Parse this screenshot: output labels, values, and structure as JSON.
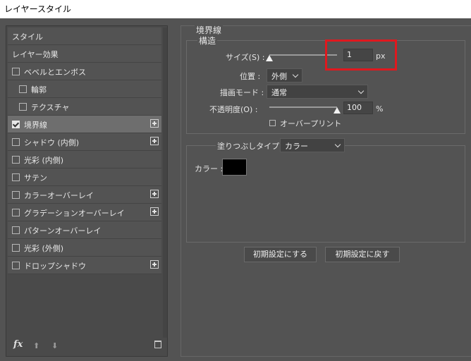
{
  "window": {
    "title": "レイヤースタイル"
  },
  "style_list": {
    "items": [
      {
        "label": "スタイル",
        "has_checkbox": false,
        "checked": false,
        "has_plus": false,
        "indent": 0,
        "selected": false
      },
      {
        "label": "レイヤー効果",
        "has_checkbox": false,
        "checked": false,
        "has_plus": false,
        "indent": 0,
        "selected": false
      },
      {
        "label": "ベベルとエンボス",
        "has_checkbox": true,
        "checked": false,
        "has_plus": false,
        "indent": 0,
        "selected": false
      },
      {
        "label": "輪郭",
        "has_checkbox": true,
        "checked": false,
        "has_plus": false,
        "indent": 1,
        "selected": false
      },
      {
        "label": "テクスチャ",
        "has_checkbox": true,
        "checked": false,
        "has_plus": false,
        "indent": 1,
        "selected": false
      },
      {
        "label": "境界線",
        "has_checkbox": true,
        "checked": true,
        "has_plus": true,
        "indent": 0,
        "selected": true
      },
      {
        "label": "シャドウ (内側)",
        "has_checkbox": true,
        "checked": false,
        "has_plus": true,
        "indent": 0,
        "selected": false
      },
      {
        "label": "光彩 (内側)",
        "has_checkbox": true,
        "checked": false,
        "has_plus": false,
        "indent": 0,
        "selected": false
      },
      {
        "label": "サテン",
        "has_checkbox": true,
        "checked": false,
        "has_plus": false,
        "indent": 0,
        "selected": false
      },
      {
        "label": "カラーオーバーレイ",
        "has_checkbox": true,
        "checked": false,
        "has_plus": true,
        "indent": 0,
        "selected": false
      },
      {
        "label": "グラデーションオーバーレイ",
        "has_checkbox": true,
        "checked": false,
        "has_plus": true,
        "indent": 0,
        "selected": false
      },
      {
        "label": "パターンオーバーレイ",
        "has_checkbox": true,
        "checked": false,
        "has_plus": false,
        "indent": 0,
        "selected": false
      },
      {
        "label": "光彩 (外側)",
        "has_checkbox": true,
        "checked": false,
        "has_plus": false,
        "indent": 0,
        "selected": false
      },
      {
        "label": "ドロップシャドウ",
        "has_checkbox": true,
        "checked": false,
        "has_plus": true,
        "indent": 0,
        "selected": false
      }
    ],
    "footer": {
      "fx_label": "fx",
      "up_icon": "arrow-up-icon",
      "down_icon": "arrow-down-icon",
      "trash_icon": "trash-icon"
    }
  },
  "stroke": {
    "group_title": "境界線",
    "structure": {
      "legend": "構造",
      "size_label": "サイズ(S) :",
      "size_value": "1",
      "size_unit": "px",
      "size_slider_fraction": 0.0,
      "position_label": "位置 :",
      "position_value": "外側",
      "blend_label": "描画モード :",
      "blend_value": "通常",
      "opacity_label": "不透明度(O) :",
      "opacity_value": "100",
      "opacity_unit": "%",
      "opacity_slider_fraction": 1.0,
      "overprint_label": "オーバープリント",
      "overprint_checked": false
    },
    "fill": {
      "type_label": "塗りつぶしタイプ :",
      "type_value": "カラー",
      "color_label": "カラー :",
      "color_hex": "#000000"
    },
    "buttons": {
      "make_default": "初期設定にする",
      "reset_default": "初期設定に戻す"
    }
  },
  "colors": {
    "highlight": "#e0181e",
    "panel_bg": "#535353",
    "selected_row": "#6e6e6e"
  }
}
